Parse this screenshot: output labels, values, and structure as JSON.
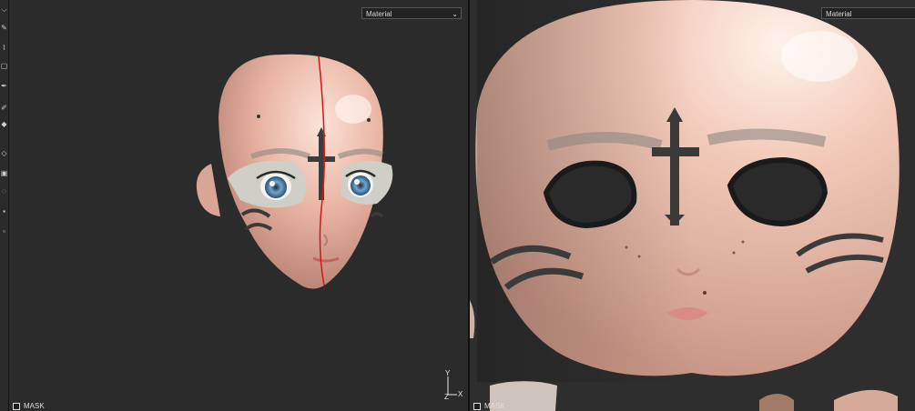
{
  "left_viewport": {
    "material_select": "Material",
    "mask_label": "MASK",
    "axis": {
      "y": "Y",
      "z": "Z",
      "x": "X"
    }
  },
  "right_viewport": {
    "material_select": "Material",
    "mask_label": "MASK"
  },
  "toolbar": {
    "tools": [
      "select-tool-icon",
      "brush-tool-icon",
      "dropper-tool-icon",
      "square-tool-icon",
      "pen-tool-icon",
      "smudge-tool-icon",
      "fill-tool-icon",
      "diamond-tool-icon",
      "clone-tool-icon",
      "lasso-tool-icon",
      "stamp-tool-icon",
      "eraser-tool-icon"
    ]
  },
  "colors": {
    "viewport_bg": "#2b2b2b",
    "skin": "#e9b9a8",
    "seam": "#d01818",
    "tattoo": "#3a3a3a"
  }
}
